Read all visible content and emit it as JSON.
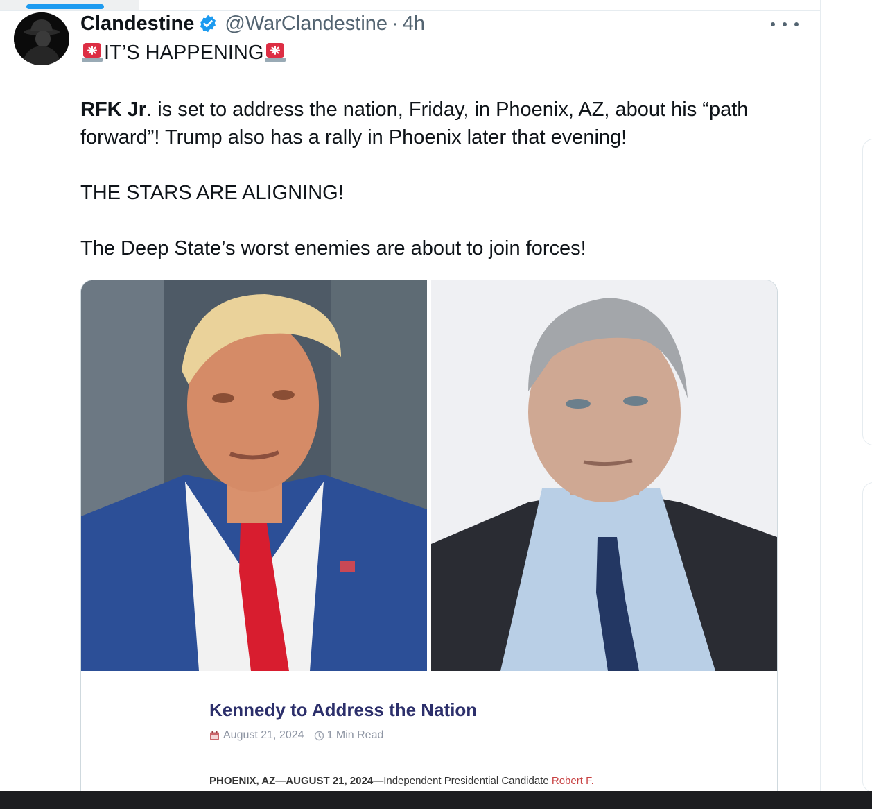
{
  "tweet": {
    "author": {
      "display_name": "Clandestine",
      "handle": "@WarClandestine",
      "verified": true
    },
    "separator": "·",
    "time": "4h",
    "headline": "IT’S HAPPENING",
    "paragraph1": {
      "bold_part": "RFK Jr",
      "line1_rest": ". is set to address the nation, Friday, in Phoenix, AZ, about his “path",
      "line2": "forward”! Trump also has a rally in Phoenix later that evening!"
    },
    "paragraph2": "THE STARS ARE ALIGNING!",
    "paragraph3": "The Deep State’s worst enemies are about to join forces!",
    "icons": {
      "headline_emoji": "police-light-icon",
      "verified_badge": "verified-badge-icon",
      "menu": "more-icon"
    }
  },
  "media": {
    "article": {
      "title": "Kennedy to Address the Nation",
      "date": "August 21, 2024",
      "read_time": "1 Min Read",
      "excerpt_bold": "PHOENIX, AZ—AUGUST 21, 2024",
      "excerpt_text": "—Independent Presidential Candidate ",
      "excerpt_link": "Robert F."
    }
  },
  "colors": {
    "verified": "#1d9bf0",
    "article_title": "#2c2f6b",
    "excerpt_link": "#c84243",
    "secondary_text": "#536471"
  }
}
